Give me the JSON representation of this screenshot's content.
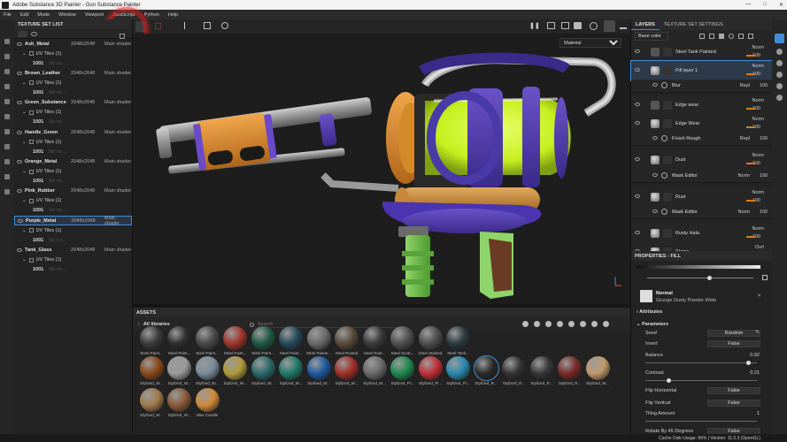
{
  "window": {
    "title": "Adobe Substance 3D Painter - Gun Substance Painter"
  },
  "menu": [
    "File",
    "Edit",
    "Mode",
    "Window",
    "Viewport",
    "JavaScript",
    "Python",
    "Help"
  ],
  "texture_set_list": {
    "title": "TEXTURE SET LIST",
    "sets": [
      {
        "name": "Ash_Metal",
        "resolution": "2048x2048",
        "shader": "Main shader",
        "uv": "UV Tiles (1)",
        "tile": "1001",
        "placeholder": "No no...",
        "selected": false
      },
      {
        "name": "Brown_Leather",
        "resolution": "2048x2048",
        "shader": "Main shader",
        "uv": "UV Tiles (1)",
        "tile": "1001",
        "placeholder": "No no...",
        "selected": false
      },
      {
        "name": "Green_Substance",
        "resolution": "2048x2048",
        "shader": "Main shader",
        "uv": "UV Tiles (1)",
        "tile": "1001",
        "placeholder": "No no...",
        "selected": false
      },
      {
        "name": "Handle_Green",
        "resolution": "2048x2048",
        "shader": "Main shader",
        "uv": "UV Tiles (1)",
        "tile": "1001",
        "placeholder": "No no...",
        "selected": false
      },
      {
        "name": "Orange_Metal",
        "resolution": "2048x2048",
        "shader": "Main shader",
        "uv": "UV Tiles (1)",
        "tile": "1001",
        "placeholder": "No no...",
        "selected": false
      },
      {
        "name": "Pink_Rubber",
        "resolution": "2048x2048",
        "shader": "Main shader",
        "uv": "UV Tiles (1)",
        "tile": "1001",
        "placeholder": "No no...",
        "selected": false
      },
      {
        "name": "Purple_Metal",
        "resolution": "2048x2048",
        "shader": "Main shader",
        "uv": "UV Tiles (1)",
        "tile": "1001",
        "placeholder": "No no...",
        "selected": true
      },
      {
        "name": "Tank_Glass",
        "resolution": "2048x2048",
        "shader": "Main shader",
        "uv": "UV Tiles (1)",
        "tile": "1001",
        "placeholder": "No no...",
        "selected": false
      }
    ]
  },
  "viewport": {
    "mode_dropdown": "Material"
  },
  "assets": {
    "title": "ASSETS",
    "library": "All libraries",
    "search_placeholder": "Search",
    "materials": [
      {
        "label": "Steel Paint...",
        "color": "#3c3c3c"
      },
      {
        "label": "Steel Paint...",
        "color": "#2f2f2f"
      },
      {
        "label": "Steel Paint...",
        "color": "#4a4a4a"
      },
      {
        "label": "Steel Paint...",
        "color": "#a0362c"
      },
      {
        "label": "Steel Paint...",
        "color": "#1f5a45"
      },
      {
        "label": "Steel Paint...",
        "color": "#264a5a"
      },
      {
        "label": "Steel Painte...",
        "color": "#6a6a6a"
      },
      {
        "label": "Steel Rusted",
        "color": "#5a4a3a"
      },
      {
        "label": "Steel Rust...",
        "color": "#3a3a3a"
      },
      {
        "label": "Steel Scrat...",
        "color": "#505050"
      },
      {
        "label": "Steel Stained",
        "color": "#4e4e4e"
      },
      {
        "label": "Steel Tank...",
        "color": "#2d3a3e"
      },
      {
        "label": "Stylized_W...",
        "color": "#8a4a1a"
      },
      {
        "label": "Stylized_W...",
        "color": "#9a9a9a"
      },
      {
        "label": "Stylized_W...",
        "color": "#7a8a9a"
      },
      {
        "label": "Stylized_W...",
        "color": "#b09a3a"
      },
      {
        "label": "Stylized_W...",
        "color": "#2a6a6a"
      },
      {
        "label": "Stylized_M...",
        "color": "#1f7a6a"
      },
      {
        "label": "Stylized_M...",
        "color": "#1f5aa0"
      },
      {
        "label": "Stylized_M...",
        "color": "#a03028"
      },
      {
        "label": "Stylized_M...",
        "color": "#6a6a6a"
      },
      {
        "label": "Stylized_Pl...",
        "color": "#1e8a4e"
      },
      {
        "label": "Stylized_Pl...",
        "color": "#c03038"
      },
      {
        "label": "Stylized_Pl...",
        "color": "#2a8ab0"
      },
      {
        "label": "Stylized_R...",
        "color": "#2a2a2a"
      },
      {
        "label": "Stylized_R...",
        "color": "#333333"
      },
      {
        "label": "Stylized_R...",
        "color": "#383838"
      },
      {
        "label": "Stylized_R...",
        "color": "#7a2a2a"
      },
      {
        "label": "Stylized_W...",
        "color": "#c09a6a"
      },
      {
        "label": "Stylized_W...",
        "color": "#a07a4a"
      },
      {
        "label": "Stylized_W...",
        "color": "#8a5a3a"
      },
      {
        "label": "Wax Candle",
        "color": "#d08a3a"
      },
      {
        "label": "Wood Acaj...",
        "color": "#b04a2a"
      },
      {
        "label": "Wood Bee...",
        "color": "#b08a6a"
      },
      {
        "label": "Wood Che...",
        "color": "#9a6a4a"
      },
      {
        "label": "Wood Shi...",
        "color": "#a07a50"
      },
      {
        "label": "Wood Wal...",
        "color": "#b08a60"
      },
      {
        "label": "Wood Wal...",
        "color": "#8a6a4a"
      }
    ],
    "selected_index": 24
  },
  "layers": {
    "tabs": [
      "LAYERS",
      "TEXTURE SET SETTINGS"
    ],
    "channel": "Base color",
    "items": [
      {
        "name": "Steel Tank Painted",
        "blend": "Norm",
        "opacity": "100",
        "type": "folder",
        "selected": false
      },
      {
        "name": "Fill layer 1",
        "blend": "Norm",
        "opacity": "100",
        "type": "fill",
        "selected": true
      },
      {
        "name": "Blur",
        "blend": "Repl",
        "opacity": "100",
        "type": "filter",
        "selected": false
      },
      {
        "name": "Edge wear",
        "blend": "Norm",
        "opacity": "100",
        "type": "folder",
        "selected": false
      },
      {
        "name": "Edge Wear",
        "blend": "Norm",
        "opacity": "100",
        "type": "fill",
        "selected": false
      },
      {
        "name": "Finish Rough",
        "blend": "Repl",
        "opacity": "100",
        "type": "filter",
        "selected": false
      },
      {
        "name": "Dust",
        "blend": "Norm",
        "opacity": "100",
        "type": "fill",
        "selected": false
      },
      {
        "name": "Mask Editor",
        "blend": "Norm",
        "opacity": "100",
        "type": "filter",
        "selected": false
      },
      {
        "name": "Rust",
        "blend": "Norm",
        "opacity": "100",
        "type": "fill",
        "selected": false
      },
      {
        "name": "Mask Editor",
        "blend": "Norm",
        "opacity": "100",
        "type": "filter",
        "selected": false
      },
      {
        "name": "Rusty Hala",
        "blend": "Norm",
        "opacity": "100",
        "type": "fill",
        "selected": false
      },
      {
        "name": "Stains",
        "blend": "Ovrl",
        "opacity": "6",
        "type": "fill",
        "selected": false
      }
    ]
  },
  "properties": {
    "title": "PROPERTIES - FILL",
    "resource_blend": "Normal",
    "resource_name": "Grunge Dusty Powder Wide",
    "attributes": "Attributes",
    "parameters": "Parameters",
    "seed_label": "Seed",
    "seed_value": "Random",
    "invert_label": "Invert",
    "invert_value": "False",
    "balance_label": "Balance",
    "balance_value": "0.92",
    "balance_level": 0.92,
    "contrast_label": "Contrast",
    "contrast_value": "0.21",
    "contrast_level": 0.21,
    "flip_h_label": "Flip Horizontal",
    "flip_h_value": "False",
    "flip_v_label": "Flip Vertical",
    "flip_v_value": "False",
    "tiling_label": "Tiling Amount",
    "tiling_value": "1",
    "rotate_label": "Rotate By 45 Degrees",
    "rotate_value": "False"
  },
  "status": {
    "text": "Cache Disk Usage:   96% | Version: 11.0.3 (OpenGL)"
  }
}
